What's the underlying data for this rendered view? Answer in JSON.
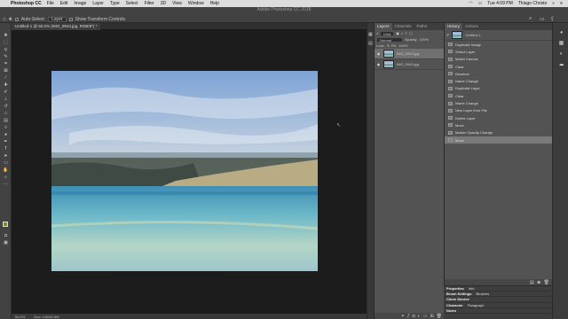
{
  "menubar": {
    "apple": "",
    "app_name": "Photoshop CC",
    "items": [
      "File",
      "Edit",
      "Image",
      "Layer",
      "Type",
      "Select",
      "Filter",
      "3D",
      "View",
      "Window",
      "Help"
    ],
    "clock": "Tue 4:09 PM",
    "user": "Thiago Christo"
  },
  "options_bar": {
    "window_title": "Adobe Photoshop CC 2018",
    "auto_select": "Auto-Select:",
    "layer_select": "Layer",
    "show_transform": "Show Transform Controls"
  },
  "document": {
    "tab_title": "Untitled-1 @ 50.2% (IMG_0943.jpg, RGB/8*) *",
    "status_zoom": "50.2%",
    "status_profile": "Doc: 2.6M/2.6M"
  },
  "layers_panel": {
    "tabs": [
      "Layers",
      "Channels",
      "Paths"
    ],
    "kind_label": "Kind",
    "blend_mode": "Normal",
    "opacity_label": "Opacity:",
    "opacity_value": "100%",
    "lock_label": "Lock:",
    "fill_label": "Fill:",
    "fill_value": "100%",
    "layers": [
      {
        "name": "IMG_0943.jpg",
        "selected": true
      },
      {
        "name": "IMG_0943.jpg",
        "selected": false
      }
    ]
  },
  "history_panel": {
    "tabs": [
      "History",
      "Actions"
    ],
    "snapshot": "Untitled-1",
    "items": [
      "Duplicate Image",
      "Select Layer",
      "Match Canvas",
      "Clear",
      "Deselect",
      "Name Change",
      "Duplicate Layer",
      "Clear",
      "Name Change",
      "New Layer from File",
      "Delete Layer",
      "Move",
      "Master Opacity Change",
      "Move"
    ],
    "selected_index": 13
  },
  "collapsed_panels": [
    {
      "title": "Properties",
      "sub": "Info"
    },
    {
      "title": "Brush Settings",
      "sub": "Brushes"
    },
    {
      "title": "Clone Source",
      "sub": ""
    },
    {
      "title": "Character",
      "sub": "Paragraph"
    },
    {
      "title": "Notes",
      "sub": ""
    }
  ]
}
